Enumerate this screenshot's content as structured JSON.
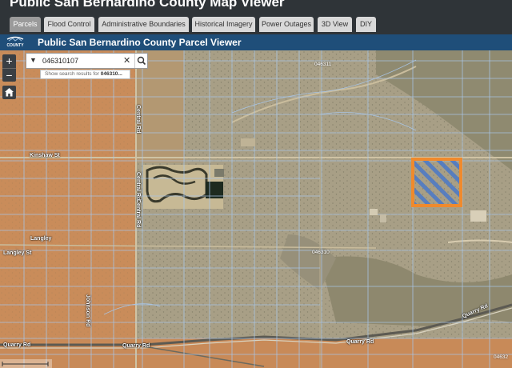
{
  "app": {
    "title": "Public San Bernardino County Map Viewer"
  },
  "tabs": [
    {
      "label": "Parcels",
      "active": true
    },
    {
      "label": "Flood Control",
      "active": false
    },
    {
      "label": "Administrative Boundaries",
      "active": false
    },
    {
      "label": "Historical Imagery",
      "active": false
    },
    {
      "label": "Power Outages",
      "active": false
    },
    {
      "label": "3D View",
      "active": false
    },
    {
      "label": "DIY",
      "active": false
    }
  ],
  "header": {
    "title": "Public San Bernardino County Parcel Viewer",
    "logo_text": "COUNTY"
  },
  "zoom": {
    "in_symbol": "+",
    "out_symbol": "−"
  },
  "search": {
    "value": "046310107",
    "clear_symbol": "✕",
    "suggestion_prefix": "Show search results for ",
    "suggestion_value": "046310..."
  },
  "map": {
    "road_labels": {
      "kinshaw": "Kinshaw St",
      "langley": "Langley",
      "langley_st": "Langley St",
      "central_top": "Central Rd",
      "central_mid": "Central Rd",
      "central_low": "Central Rd",
      "johnson": "Johnson Rd",
      "quarry_left": "Quarry Rd",
      "quarry_mid1": "Quarry Rd",
      "quarry_mid2": "Quarry Rd",
      "quarry_right": "Quarry Rd"
    },
    "parcel_labels": {
      "top": "046311",
      "mid": "046310",
      "right": "04632"
    },
    "selection_color": "#f08a2c",
    "selection_hatch_color": "#4a78c8",
    "parcel_line_color": "#a9c6e8"
  }
}
